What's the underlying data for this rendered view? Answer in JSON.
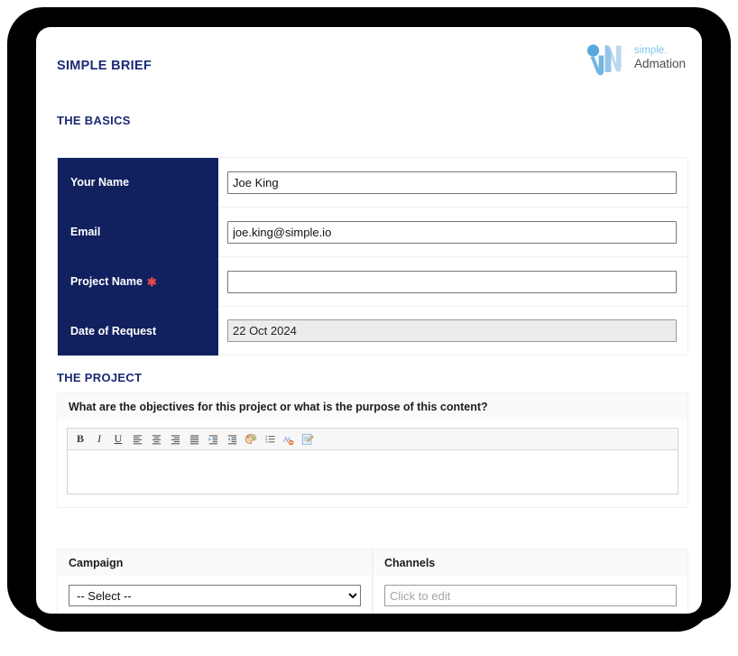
{
  "document": {
    "title": "SIMPLE BRIEF",
    "sections": {
      "basics_heading": "THE BASICS",
      "project_heading": "THE PROJECT"
    }
  },
  "logo": {
    "simple_text": "simple.",
    "admation_text": "Admation",
    "mark_color_light": "#bcd9f0",
    "mark_color_mid": "#7fb9e4",
    "mark_color_dot": "#5aa8dd",
    "simple_color": "#7ec5ea",
    "admation_color": "#4b4b4b"
  },
  "theme": {
    "navy": "#11205e",
    "heading_blue": "#1b2a73",
    "required_red": "#e24b4b",
    "field_border": "#767676",
    "disabled_bg": "#ececec",
    "row_border": "#f0f0f0",
    "header_bg": "#fafafa"
  },
  "basics": {
    "rows": [
      {
        "label": "Your Name",
        "required": false,
        "value": "Joe King",
        "placeholder": "",
        "disabled": false
      },
      {
        "label": "Email",
        "required": false,
        "value": "joe.king@simple.io",
        "placeholder": "",
        "disabled": false
      },
      {
        "label": "Project Name",
        "required": true,
        "value": "",
        "placeholder": "",
        "disabled": false
      },
      {
        "label": "Date of Request",
        "required": false,
        "value": "22 Oct 2024",
        "placeholder": "",
        "disabled": true
      }
    ],
    "required_marker": "✱"
  },
  "project": {
    "question": "What are the objectives for this project or what is the purpose of this content?",
    "editor": {
      "content": "",
      "toolbar": [
        {
          "name": "bold-icon",
          "label": "B",
          "title": "Bold"
        },
        {
          "name": "italic-icon",
          "label": "I",
          "title": "Italic"
        },
        {
          "name": "underline-icon",
          "label": "U",
          "title": "Underline"
        },
        {
          "name": "align-left-icon",
          "label": "",
          "title": "Align Left"
        },
        {
          "name": "align-center-icon",
          "label": "",
          "title": "Align Center"
        },
        {
          "name": "align-right-icon",
          "label": "",
          "title": "Align Right"
        },
        {
          "name": "align-justify-icon",
          "label": "",
          "title": "Justify"
        },
        {
          "name": "indent-increase-icon",
          "label": "",
          "title": "Increase Indent"
        },
        {
          "name": "indent-decrease-icon",
          "label": "",
          "title": "Decrease Indent"
        },
        {
          "name": "text-color-palette-icon",
          "label": "",
          "title": "Text Colour"
        },
        {
          "name": "bulleted-list-icon",
          "label": "",
          "title": "Bulleted List"
        },
        {
          "name": "remove-format-icon",
          "label": "",
          "title": "Remove Format"
        },
        {
          "name": "edit-source-icon",
          "label": "",
          "title": "Edit Source"
        }
      ]
    }
  },
  "campaign": {
    "label": "Campaign",
    "selected": "-- Select --",
    "options": [
      "-- Select --"
    ]
  },
  "channels": {
    "label": "Channels",
    "value": "",
    "placeholder": "Click to edit"
  }
}
